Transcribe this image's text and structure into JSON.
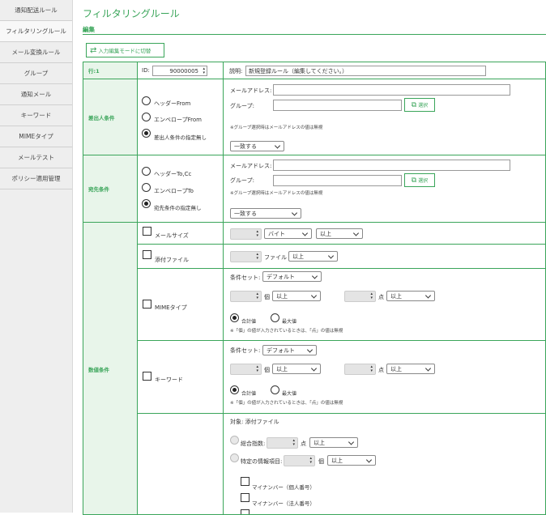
{
  "sidebar": {
    "items": [
      "通知配送ルール",
      "フィルタリングルール",
      "メール変換ルール",
      "グループ",
      "通知メール",
      "キーワード",
      "MIMEタイプ",
      "メールテスト",
      "ポリシー適用管理"
    ]
  },
  "page": {
    "title": "フィルタリングルール",
    "subtitle": "編集",
    "mode_button": "入力編集モードに切替"
  },
  "row": {
    "label": "行:1",
    "id_label": "ID:",
    "id_value": "90000005",
    "desc_label": "説明:",
    "desc_value": "新規登録ルール（編集してください。）"
  },
  "sender": {
    "label": "差出人条件",
    "opt1": "ヘッダーFrom",
    "opt2": "エンベロープFrom",
    "opt3": "差出人条件の指定無し",
    "email_label": "メールアドレス:",
    "group_label": "グループ:",
    "select_button": "選択",
    "note": "※グループ選択時はメールアドレスの値は無視",
    "match": "一致する"
  },
  "recipient": {
    "label": "宛先条件",
    "opt1": "ヘッダーTo,Cc",
    "opt2": "エンベロープTo",
    "opt3": "宛先条件の指定無し",
    "email_label": "メールアドレス:",
    "group_label": "グループ:",
    "select_button": "選択",
    "note": "※グループ選択時はメールアドレスの値は無視",
    "match": "一致する"
  },
  "numeric": {
    "label": "数値条件",
    "mail_size": {
      "label": "メールサイズ",
      "unit": "バイト",
      "cmp": "以上"
    },
    "attach": {
      "label": "添付ファイル",
      "unit": "ファイル",
      "cmp": "以上"
    },
    "mime": {
      "label": "MIMEタイプ",
      "set_label": "条件セット:",
      "set_value": "デフォルト",
      "count_unit": "個",
      "count_cmp": "以上",
      "point_unit": "点",
      "point_cmp": "以上",
      "radio_total": "合計値",
      "radio_max": "最大値",
      "note": "※「個」の値が入力されているときは、「点」の値は無視"
    },
    "keyword": {
      "label": "キーワード",
      "set_label": "条件セット:",
      "set_value": "デフォルト",
      "count_unit": "個",
      "count_cmp": "以上",
      "point_unit": "点",
      "point_cmp": "以上",
      "radio_total": "合計値",
      "radio_max": "最大値",
      "note": "※「個」の値が入力されているときは、「点」の値は無視"
    },
    "target": {
      "label": "対象: 添付ファイル",
      "total_label": "総合指数:",
      "total_unit": "点",
      "total_cmp": "以上",
      "specific_label": "特定の情報項目:",
      "specific_unit": "個",
      "specific_cmp": "以上",
      "item1": "マイナンバー（個人番号）",
      "item2": "マイナンバー（法人番号）"
    }
  }
}
